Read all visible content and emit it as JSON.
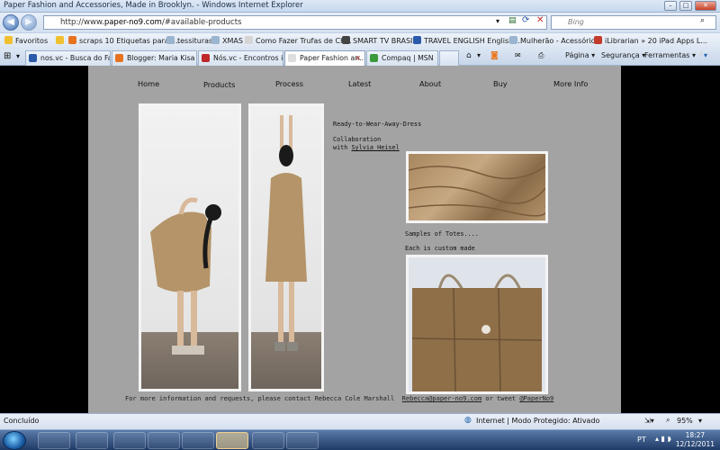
{
  "window": {
    "title": "Paper Fashion and Accessories, Made in Brooklyn. - Windows Internet Explorer",
    "min": "–",
    "max": "□",
    "close": "✕"
  },
  "nav": {
    "url_prefix": "http://www.",
    "url_domain": "paper-no9.com",
    "url_suffix": "/#available-products",
    "search_placeholder": "Bing"
  },
  "favorites": {
    "label": "Favoritos",
    "items": [
      "scraps 10 Etiquetas para I...",
      "tessituras",
      "XMAS",
      "Como Fazer Trufas de Ch...",
      "SMART TV BRASIL",
      "TRAVEL ENGLISH English ...",
      "Mulherão - Acessórios",
      "iLibrarian » 20 iPad Apps L..."
    ]
  },
  "tabs": [
    "nos.vc - Busca do Fac...",
    "Blogger: Maria Kisa - ...",
    "Nós.vc - Encontros in...",
    "Paper Fashion an...",
    "Compaq | MSN"
  ],
  "commands": {
    "page": "Página",
    "security": "Segurança",
    "tools": "Ferramentas"
  },
  "site": {
    "menu": [
      "Home",
      "Products",
      "Process",
      "Latest",
      "About",
      "Buy",
      "More Info"
    ],
    "dress_title": "Ready-to-Wear-Away-Dress",
    "collab": "Collaboration",
    "with": "with",
    "collab_name": "Sylvia Heisel",
    "totes_samples": "Samples of Totes....",
    "totes_custom": "Each is custom made",
    "footer_text": "For more information and requests, please contact Rebecca Cole Marshall",
    "footer_email": "Rebecca@paper-no9.com",
    "footer_or": "or tweet",
    "footer_twitter": "@PaperNo9"
  },
  "status": {
    "left": "Concluído",
    "zone": "Internet | Modo Protegido: Ativado",
    "zoom": "95%"
  },
  "taskbar": {
    "lang": "PT",
    "time": "18:27",
    "date": "12/12/2011"
  },
  "colors": {
    "site_bg": "#a3a3a3",
    "paper": "#b49468"
  }
}
